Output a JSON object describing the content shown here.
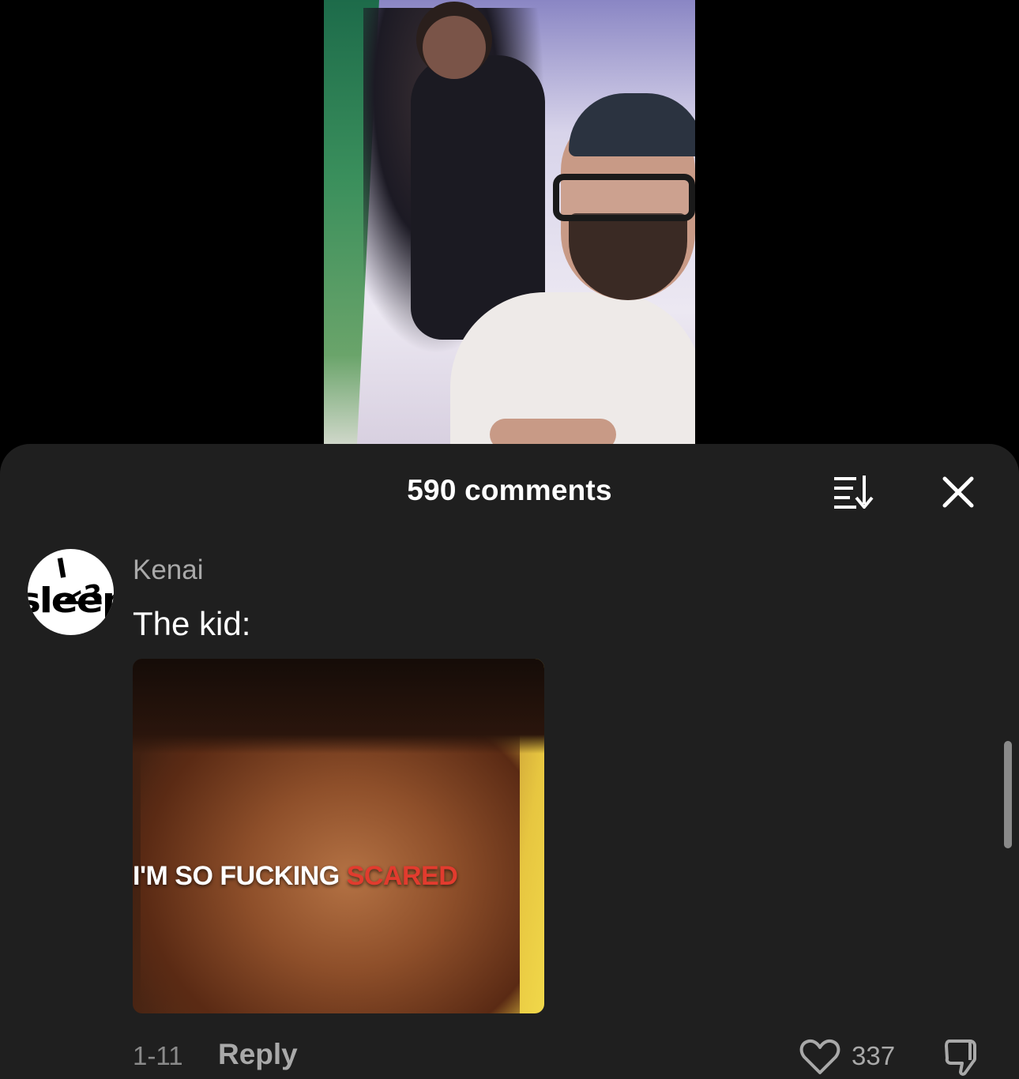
{
  "sheet": {
    "title": "590 comments"
  },
  "comment": {
    "avatar_text_top": "I <3",
    "avatar_text_bottom": "sleep",
    "username": "Kenai",
    "text": "The kid:",
    "gif_caption_white": "I'M SO FUCKING ",
    "gif_caption_red": "SCARED",
    "date": "1-11",
    "reply_label": "Reply",
    "like_count": "337"
  },
  "icons": {
    "sort": "sort-icon",
    "close": "close-icon",
    "heart": "heart-icon",
    "dislike": "thumbs-down-icon"
  },
  "colors": {
    "sheet_bg": "#1f1f1f",
    "primary_text": "#ffffff",
    "secondary_text": "#a9a9a9",
    "caption_red": "#e23b2e"
  }
}
